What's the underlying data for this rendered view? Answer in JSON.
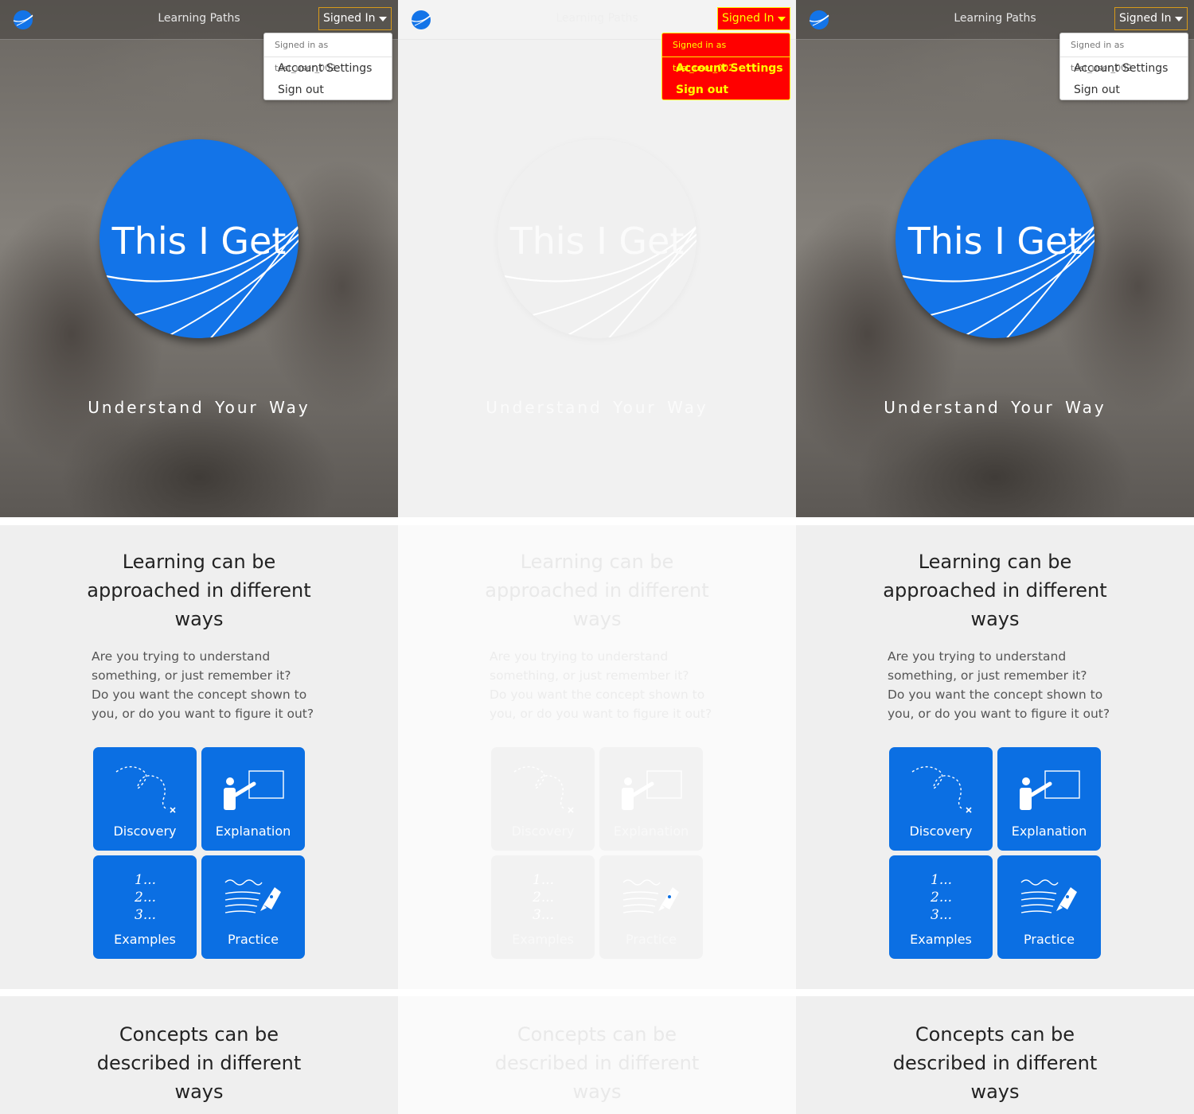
{
  "nav": {
    "link": "Learning Paths",
    "signin_label": "Signed In"
  },
  "account_menu": {
    "header": "Signed in as test_user_002",
    "items": [
      "Account Settings",
      "Sign out"
    ]
  },
  "hero": {
    "brand": "This I Get",
    "tagline": "Understand Your Way"
  },
  "approaches": {
    "title_lines": [
      "Learning can be",
      "approached in different",
      "ways"
    ],
    "body_lines": [
      "Are you trying to understand",
      "something, or just remember it?",
      "Do you want the concept shown to",
      "you, or do you want to figure it out?"
    ],
    "tiles": [
      {
        "label": "Discovery",
        "icon": "dotted-path-icon"
      },
      {
        "label": "Explanation",
        "icon": "presenter-board-icon"
      },
      {
        "label": "Examples",
        "icon": "numbered-list-icon"
      },
      {
        "label": "Practice",
        "icon": "pen-writing-icon"
      }
    ],
    "numbered_marks": [
      "1...",
      "2...",
      "3..."
    ]
  },
  "concepts": {
    "title_lines": [
      "Concepts can be",
      "described in different",
      "ways"
    ]
  },
  "colors": {
    "brand_blue": "#1374e8",
    "tile_blue": "#0b6fe3",
    "signin_border": "#d89a1a",
    "highlight_red": "#ff0000",
    "highlight_yellow": "#ffff00"
  }
}
